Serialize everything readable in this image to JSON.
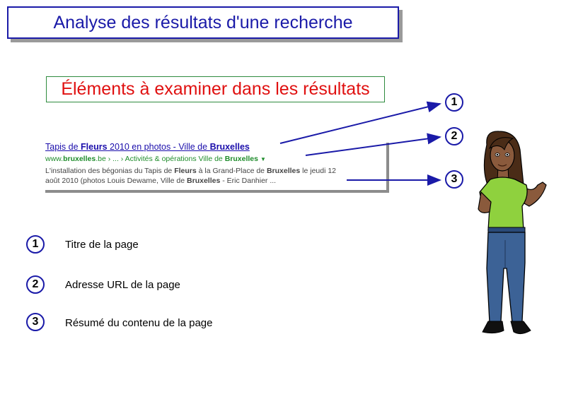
{
  "title": "Analyse des résultats d'une recherche",
  "subtitle": "Éléments à examiner dans les résultats",
  "search_result": {
    "title_parts": [
      "Tapis de ",
      "Fleurs",
      " 2010 en photos - Ville de ",
      "Bruxelles"
    ],
    "url_parts": [
      "www.",
      "bruxelles",
      ".be › ... › Activités & opérations Ville de ",
      "Bruxelles"
    ],
    "snippet_line1_parts": [
      "L'installation des bégonias du Tapis de ",
      "Fleurs",
      " à la Grand-Place de ",
      "Bruxelles",
      " le jeudi 12"
    ],
    "snippet_line2_parts": [
      "août 2010 (photos Louis Dewame, Ville de ",
      "Bruxelles",
      " - Eric Danhier ..."
    ]
  },
  "callouts": [
    "1",
    "2",
    "3"
  ],
  "legend": [
    {
      "number": "1",
      "label": "Titre de la page"
    },
    {
      "number": "2",
      "label": "Adresse URL de la page"
    },
    {
      "number": "3",
      "label": "Résumé du contenu de la page"
    }
  ],
  "colors": {
    "accent": "#1a1aa8",
    "subtitle_text": "#e01010",
    "subtitle_border": "#2e8b3e",
    "link": "#1a0dab",
    "url": "#1e8c2b"
  }
}
